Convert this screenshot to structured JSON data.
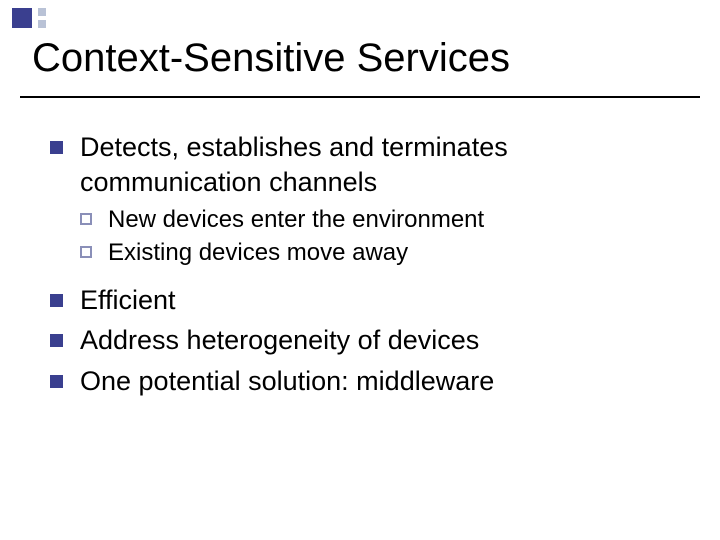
{
  "title": "Context-Sensitive Services",
  "bullets": {
    "b1": "Detects, establishes and terminates communication channels",
    "b1_subs": {
      "s1": "New devices enter the environment",
      "s2": "Existing devices move away"
    },
    "b2": "Efficient",
    "b3": "Address heterogeneity of devices",
    "b4": "One potential solution: middleware"
  }
}
